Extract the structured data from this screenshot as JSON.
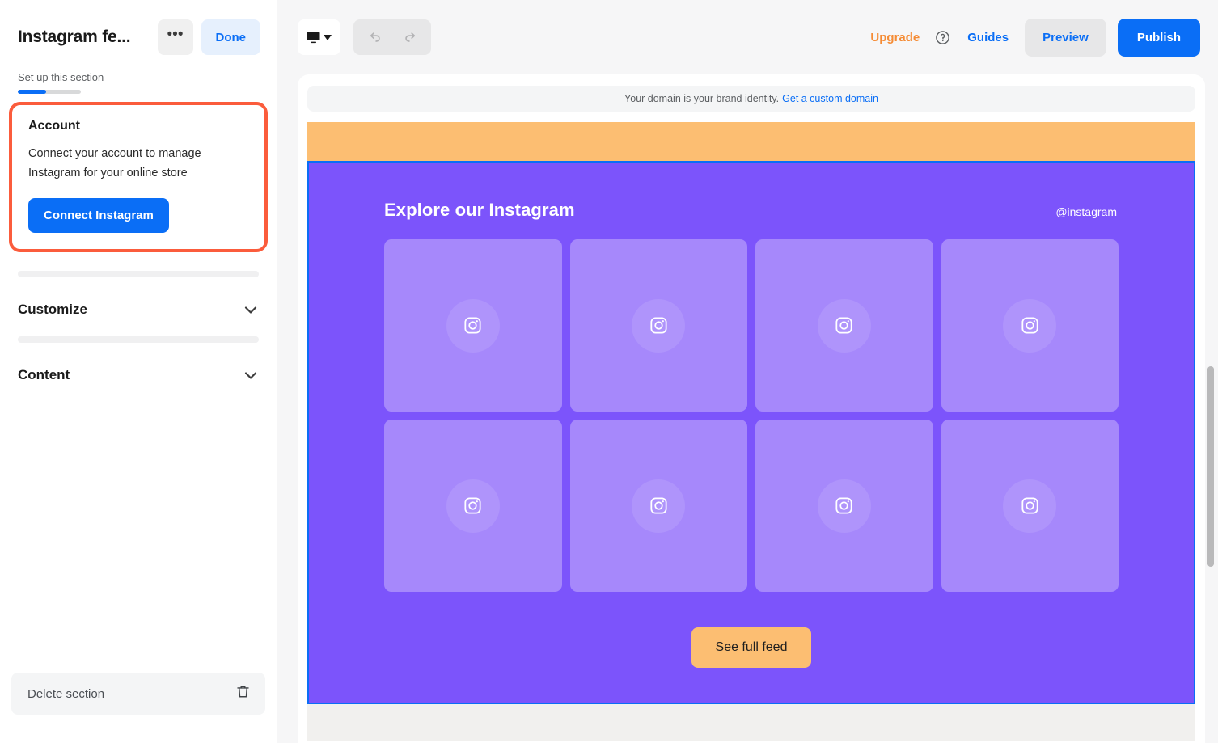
{
  "sidebar": {
    "title": "Instagram fe...",
    "more_label": "•••",
    "done_label": "Done",
    "setup_label": "Set up this section",
    "progress_percent": 45,
    "account": {
      "title": "Account",
      "description": "Connect your account to manage Instagram for your online store",
      "connect_label": "Connect Instagram",
      "highlight_color": "#fb5c3c"
    },
    "sections": [
      {
        "label": "Customize",
        "icon": "chevron-down-icon"
      },
      {
        "label": "Content",
        "icon": "chevron-down-icon"
      }
    ],
    "delete": {
      "label": "Delete section",
      "icon": "trash-icon"
    }
  },
  "toolbar": {
    "device_icon": "desktop-monitor-icon",
    "device_caret_icon": "caret-down-icon",
    "undo_icon": "undo-arrow-icon",
    "redo_icon": "redo-arrow-icon",
    "upgrade_label": "Upgrade",
    "help_icon": "question-mark-circle-icon",
    "guides_label": "Guides",
    "preview_label": "Preview",
    "publish_label": "Publish",
    "accent_blue": "#0a6ef6",
    "accent_orange": "#f58b34"
  },
  "canvas": {
    "domain_banner": {
      "text": "Your domain is your brand identity.",
      "link_label": "Get a custom domain"
    },
    "instagram_section": {
      "heading": "Explore our Instagram",
      "handle": "@instagram",
      "background_color": "#7c54fb",
      "tile_color": "#a688fb",
      "tiles": [
        {
          "icon": "instagram-icon"
        },
        {
          "icon": "instagram-icon"
        },
        {
          "icon": "instagram-icon"
        },
        {
          "icon": "instagram-icon"
        },
        {
          "icon": "instagram-icon"
        },
        {
          "icon": "instagram-icon"
        },
        {
          "icon": "instagram-icon"
        },
        {
          "icon": "instagram-icon"
        }
      ],
      "cta_label": "See full feed",
      "cta_color": "#fcbe72"
    }
  }
}
